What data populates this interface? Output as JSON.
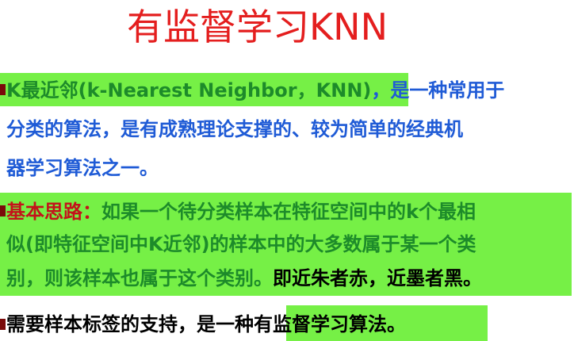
{
  "title": "有监督学习KNN",
  "para1": {
    "hl_text": "K最近邻(k-Nearest Neighbor，KNN)",
    "rest1": "，是一种常用于",
    "line2": "分类的算法，是有成熟理论支撑的、较为简单的经典机",
    "line3": "器学习算法之一。"
  },
  "para2": {
    "label": "基本思路：",
    "line1": "如果一个待分类样本在特征空间中的k个最相",
    "line2": "似(即特征空间中K近邻)的样本中的大多数属于某一个类",
    "line3a": "别，则该样本也属于这个类别。",
    "line3b": "即近朱者赤，近墨者黑。"
  },
  "para3": {
    "prefix": "需要样本标签的支持，是一种",
    "hl_text": "有监督学习算法。"
  },
  "colors": {
    "title": "#e41e1e",
    "highlight": "#76f046",
    "blue": "#1f5bd6",
    "green": "#1d8b2a",
    "red": "#c4121a"
  }
}
